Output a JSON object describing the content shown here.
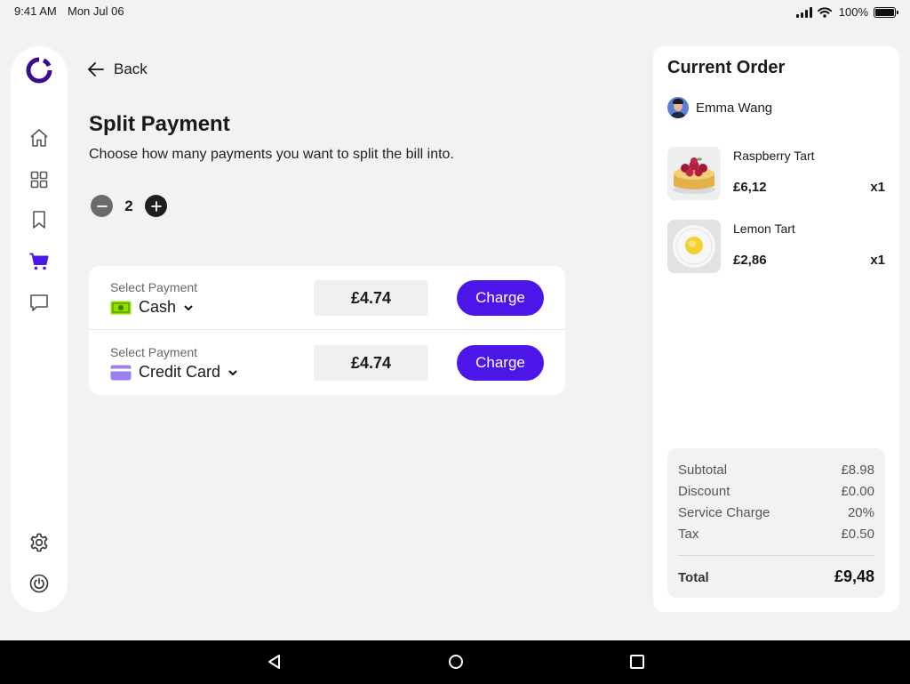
{
  "status": {
    "time": "9:41 AM",
    "date": "Mon Jul 06",
    "battery": "100%"
  },
  "sidebar": {
    "items": [
      {
        "name": "home",
        "icon": "home-icon"
      },
      {
        "name": "grid",
        "icon": "grid-icon"
      },
      {
        "name": "bookmark",
        "icon": "bookmark-icon"
      },
      {
        "name": "cart",
        "icon": "cart-icon",
        "active": true
      },
      {
        "name": "chat",
        "icon": "chat-icon"
      },
      {
        "name": "settings",
        "icon": "gear-icon"
      },
      {
        "name": "power",
        "icon": "power-icon"
      }
    ]
  },
  "header": {
    "back_label": "Back"
  },
  "split": {
    "title": "Split Payment",
    "subtitle": "Choose how many payments you want to split the bill into.",
    "count": "2",
    "payments": [
      {
        "label": "Select Payment",
        "method": "Cash",
        "amount": "£4.74",
        "action": "Charge"
      },
      {
        "label": "Select Payment",
        "method": "Credit Card",
        "amount": "£4.74",
        "action": "Charge"
      }
    ]
  },
  "order": {
    "title": "Current Order",
    "customer": "Emma Wang",
    "items": [
      {
        "name": "Raspberry Tart",
        "price": "£6,12",
        "qty": "x1"
      },
      {
        "name": "Lemon Tart",
        "price": "£2,86",
        "qty": "x1"
      }
    ],
    "summary": [
      {
        "label": "Subtotal",
        "value": "£8.98"
      },
      {
        "label": "Discount",
        "value": "£0.00"
      },
      {
        "label": "Service Charge",
        "value": "20%"
      },
      {
        "label": "Tax",
        "value": "£0.50"
      }
    ],
    "total_label": "Total",
    "total_value": "£9,48"
  },
  "colors": {
    "accent": "#4d16e8",
    "cash_icon": "#8ee000",
    "card_icon": "#9b7ff0"
  }
}
